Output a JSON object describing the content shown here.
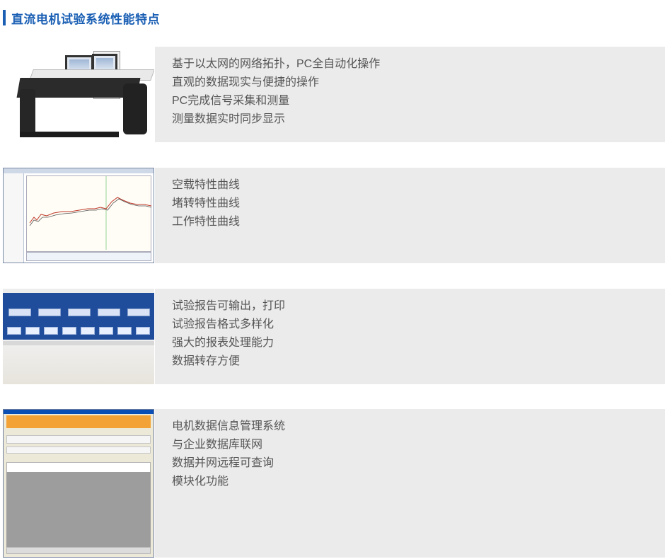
{
  "header": {
    "title": "直流电机试验系统性能特点"
  },
  "sections": [
    {
      "image_name": "test-bench-desk-image",
      "features": [
        "基于以太网的网络拓扑，PC全自动化操作",
        "直观的数据现实与便捷的操作",
        "PC完成信号采集和测量",
        "测量数据实时同步显示"
      ]
    },
    {
      "image_name": "characteristic-curve-software-image",
      "features": [
        "空载特性曲线",
        "堵转特性曲线",
        "工作特性曲线"
      ]
    },
    {
      "image_name": "test-report-software-image",
      "features": [
        "试验报告可输出，打印",
        "试验报告格式多样化",
        "强大的报表处理能力",
        "数据转存方便"
      ]
    },
    {
      "image_name": "motor-data-management-software-image",
      "features": [
        "电机数据信息管理系统",
        "与企业数据库联网",
        "数据并网远程可查询",
        "模块化功能"
      ]
    }
  ],
  "colors": {
    "accent": "#1a5fb4",
    "panel_bg": "#ebebeb",
    "text": "#555555"
  }
}
